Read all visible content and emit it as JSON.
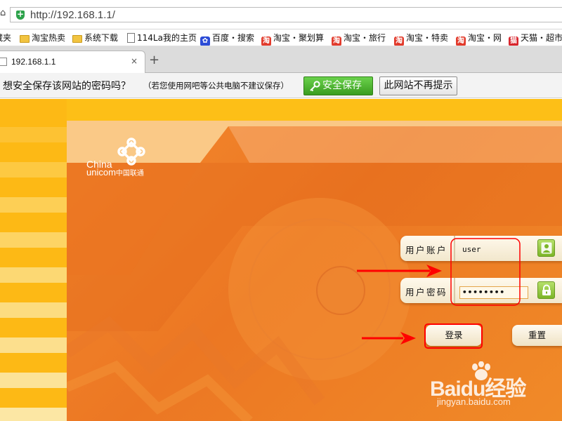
{
  "browser": {
    "url": "http://192.168.1.1/",
    "tab_title": "192.168.1.1",
    "tab_close": "×",
    "new_tab": "+",
    "home_glyph": "⌂"
  },
  "bookmarks": [
    {
      "label": "藏夹",
      "icon": "folder-icon"
    },
    {
      "label": "淘宝热卖",
      "icon": "folder-icon"
    },
    {
      "label": "系统下载",
      "icon": "folder-icon"
    },
    {
      "label": "114La我的主页",
      "icon": "page-icon"
    },
    {
      "label": "百度・搜索",
      "icon": "baidu-paw-icon"
    },
    {
      "label": "淘宝・聚划算",
      "icon": "taobao-icon"
    },
    {
      "label": "淘宝・旅行",
      "icon": "taobao-icon"
    },
    {
      "label": "淘宝・特卖",
      "icon": "taobao-icon"
    },
    {
      "label": "淘宝・网",
      "icon": "taobao-icon"
    },
    {
      "label": "天猫・超市",
      "icon": "tmall-icon"
    }
  ],
  "bookmark_icon_glyphs": {
    "taobao": "淘",
    "tmall": "猫",
    "paw": "✿"
  },
  "notification": {
    "message": "想安全保存该网站的密码吗？",
    "hint": "（若您使用网吧等公共电脑不建议保存）",
    "save_label": "安全保存",
    "never_label": "此网站不再提示"
  },
  "logo": {
    "line1": "China",
    "line2": "unicom",
    "cn": "中国联通"
  },
  "login": {
    "username_label": "用户账户",
    "username_value": "user",
    "password_label": "用户密码",
    "password_value": "••••••••",
    "login_button": "登录",
    "reset_button": "重置"
  },
  "watermark": {
    "brand": "Baidu经验",
    "url": "jingyan.baidu.com"
  },
  "colors": {
    "page_background": "#fdbf17",
    "panel": "#ec7723",
    "annotation_red": "#ff0000",
    "save_button": "#4caf2a",
    "field_icon": "#8ec63f"
  }
}
